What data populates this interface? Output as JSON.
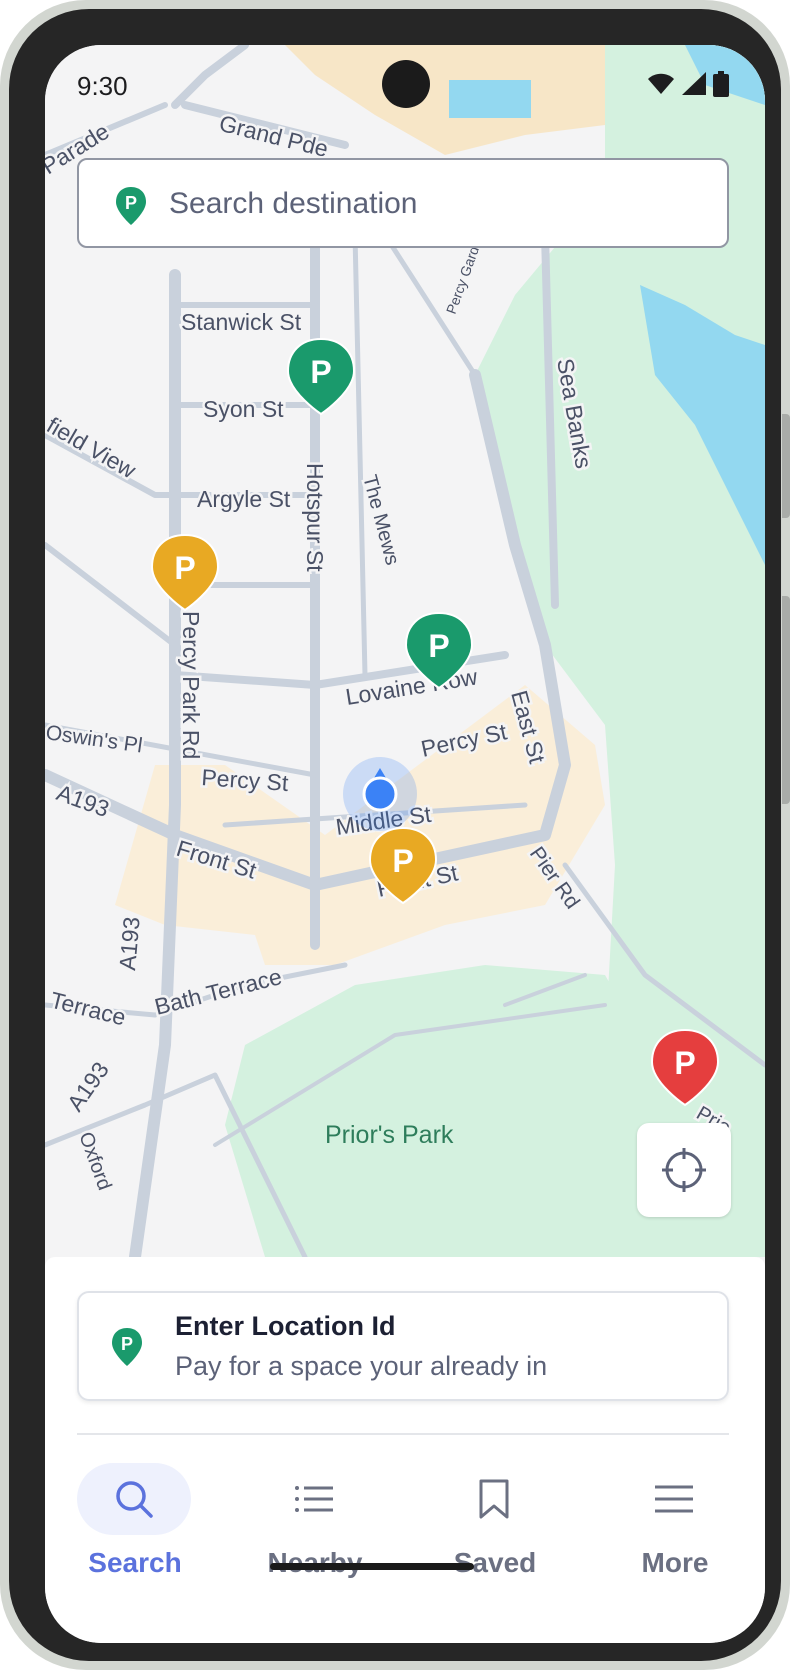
{
  "status_bar": {
    "time": "9:30"
  },
  "search": {
    "placeholder": "Search destination",
    "pin_letter": "P"
  },
  "map": {
    "streets": {
      "parade": "Parade",
      "grand_pde": "Grand Pde",
      "stanwick_st": "Stanwick St",
      "syon_st": "Syon St",
      "field_view": "field View",
      "argyle_st": "Argyle St",
      "hotspur_st": "Hotspur St",
      "the_mews": "The Mews",
      "percy_gardens": "Percy Gardens",
      "sea_banks": "Sea Banks",
      "percy_park_rd": "Percy Park Rd",
      "lovaine_row": "Lovaine Row",
      "oswins_pl": "Oswin's Pl",
      "percy_st_right": "Percy St",
      "percy_st_left": "Percy St",
      "east_st": "East St",
      "a193_top": "A193",
      "middle_st": "Middle St",
      "front_st_left": "Front St",
      "front_st_right": "Front St",
      "pier_rd": "Pier Rd",
      "a193_mid": "A193",
      "terrace": "Terrace",
      "bath_terrace": "Bath Terrace",
      "a193_bottom": "A193",
      "oxford": "Oxford",
      "priors_edge": "Prio"
    },
    "park": "Prior's Park",
    "markers": [
      {
        "type": "available",
        "letter": "P",
        "color": "#1a9a6c"
      },
      {
        "type": "limited",
        "letter": "P",
        "color": "#e8a923"
      },
      {
        "type": "available",
        "letter": "P",
        "color": "#1a9a6c"
      },
      {
        "type": "limited",
        "letter": "P",
        "color": "#e8a923"
      },
      {
        "type": "full",
        "letter": "P",
        "color": "#e53e3e"
      }
    ],
    "current_location_color": "#3b82f6"
  },
  "location_card": {
    "title": "Enter Location Id",
    "subtitle": "Pay for a space your already in",
    "pin_letter": "P"
  },
  "nav": {
    "items": [
      {
        "label": "Search",
        "icon": "search-icon",
        "active": true
      },
      {
        "label": "Nearby",
        "icon": "list-icon",
        "active": false
      },
      {
        "label": "Saved",
        "icon": "bookmark-icon",
        "active": false
      },
      {
        "label": "More",
        "icon": "menu-icon",
        "active": false
      }
    ]
  },
  "colors": {
    "accent": "#5b72dd",
    "available": "#1a9a6c",
    "limited": "#e8a923",
    "full": "#e53e3e",
    "park": "#d4f1df",
    "water": "#93d8f0"
  }
}
